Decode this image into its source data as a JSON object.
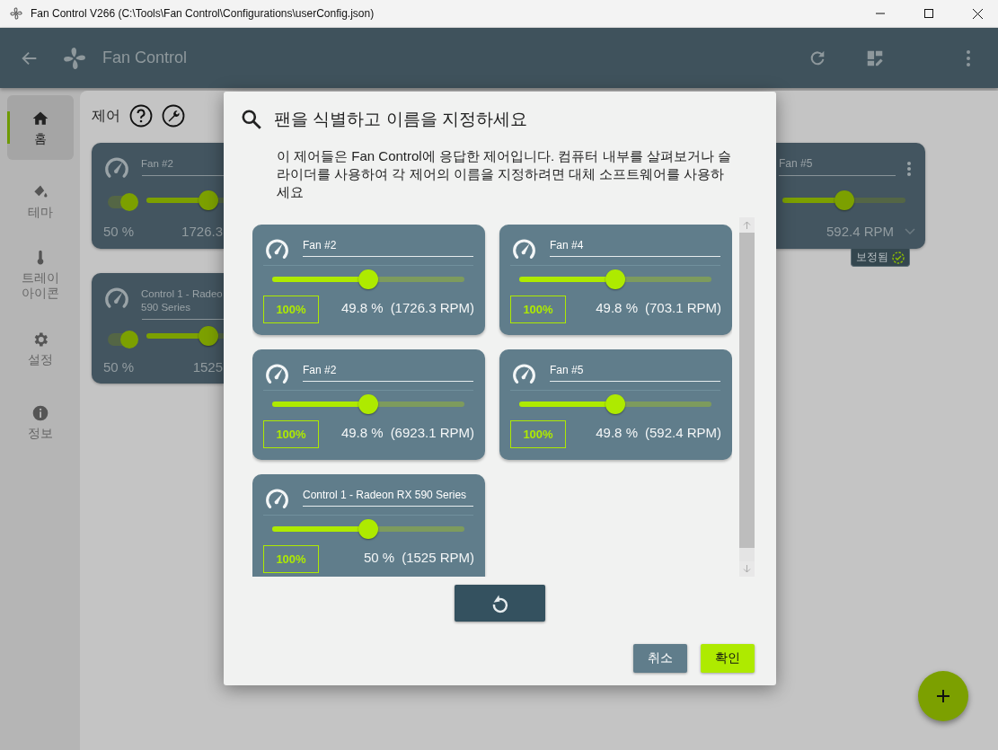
{
  "window": {
    "title": "Fan Control V266 (C:\\Tools\\Fan Control\\Configurations\\userConfig.json)"
  },
  "app_bar": {
    "title": "Fan Control"
  },
  "sidebar": {
    "items": [
      {
        "label": "홈",
        "kind": "home",
        "selected": true
      },
      {
        "label": "테마",
        "kind": "theme",
        "selected": false
      },
      {
        "label": "트레이\n아이콘",
        "kind": "tray",
        "selected": false
      },
      {
        "label": "설정",
        "kind": "settings",
        "selected": false
      },
      {
        "label": "정보",
        "kind": "info",
        "selected": false
      }
    ]
  },
  "section": {
    "title": "제어"
  },
  "left_cards": [
    {
      "name_lines": [
        "Fan #2"
      ],
      "toggle_on": true,
      "level": 0.5,
      "percent": "50 %",
      "rpm": "1726.3"
    },
    {
      "name_lines": [
        "Control 1 - Radeo",
        "590 Series"
      ],
      "toggle_on": true,
      "level": 0.5,
      "percent": "50 %",
      "rpm": "1525"
    }
  ],
  "right_card": {
    "name": "Fan #5",
    "level": 0.5,
    "rpm": "592.4 RPM",
    "badge": "보정됨"
  },
  "dialog": {
    "title": "팬을 식별하고 이름을 지정하세요",
    "description": "이 제어들은 Fan Control에 응답한 제어입니다. 컴퓨터 내부를 살펴보거나 슬라이더를 사용하여 각 제어의 이름을 지정하려면 대체 소프트웨어를 사용하세요",
    "cards": [
      {
        "name": "Fan #2",
        "level": 0.5,
        "output": "100%",
        "percent": "49.8 %",
        "rpm": "(1726.3 RPM)"
      },
      {
        "name": "Fan #4",
        "level": 0.5,
        "output": "100%",
        "percent": "49.8 %",
        "rpm": "(703.1 RPM)"
      },
      {
        "name": "Fan #2",
        "level": 0.5,
        "output": "100%",
        "percent": "49.8 %",
        "rpm": "(6923.1 RPM)"
      },
      {
        "name": "Fan #5",
        "level": 0.5,
        "output": "100%",
        "percent": "49.8 %",
        "rpm": "(592.4 RPM)"
      },
      {
        "name": "Control 1 - Radeon RX 590 Series",
        "level": 0.5,
        "output": "100%",
        "percent": "50 %",
        "rpm": "(1525 RPM)"
      }
    ],
    "cancel": "취소",
    "confirm": "확인"
  }
}
